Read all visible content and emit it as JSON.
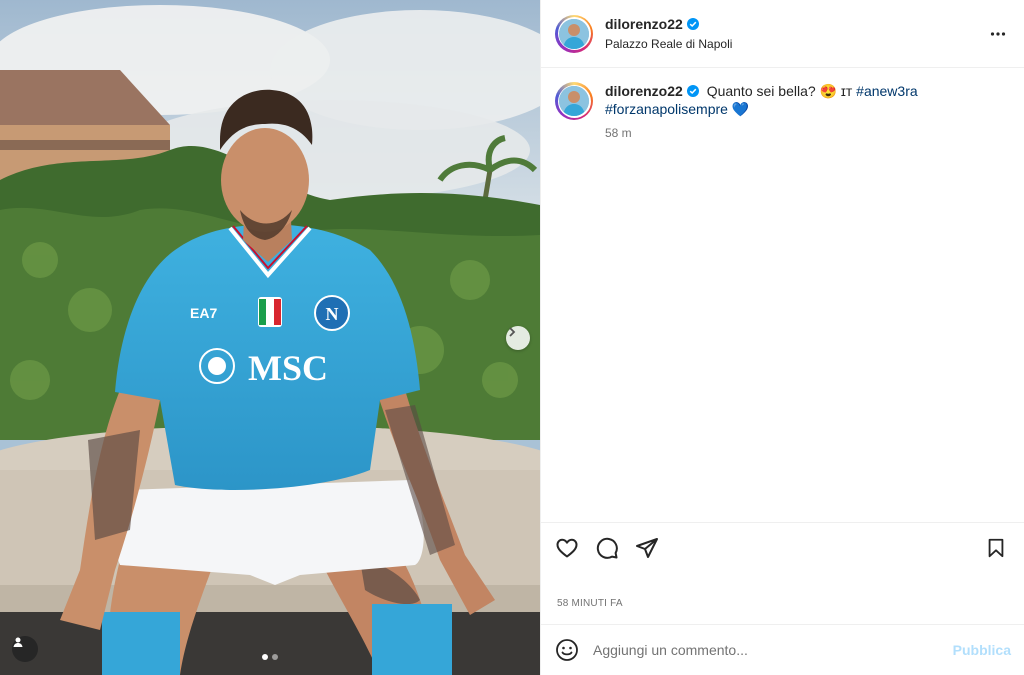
{
  "post": {
    "username": "dilorenzo22",
    "location": "Palazzo Reale di Napoli",
    "caption_text": "Quanto sei bella? 😍 ɪᴛ",
    "hashtags": [
      "#anew3ra",
      "#forzanapolisempre"
    ],
    "caption_emoji_end": "💙",
    "time_short": "58 m",
    "time_long": "58 MINUTI FA",
    "photo": {
      "jersey_text": "MSC",
      "jersey_sponsor": "EA7",
      "crest_letter": "N"
    }
  },
  "comment": {
    "placeholder": "Aggiungi un commento...",
    "publish_label": "Pubblica"
  },
  "icons": {
    "verified": "verified-badge-icon",
    "more": "more-options-icon",
    "like": "heart-icon",
    "comment": "comment-bubble-icon",
    "share": "paper-plane-icon",
    "save": "bookmark-icon",
    "emoji": "emoji-icon",
    "next": "chevron-right-icon",
    "tag": "user-tag-icon"
  },
  "colors": {
    "verified_blue": "#0095f6",
    "hashtag_blue": "#00376b",
    "publish_disabled": "#b2dffc",
    "jersey_blue": "#35a6d8"
  },
  "carousel": {
    "count": 2,
    "current": 1
  }
}
